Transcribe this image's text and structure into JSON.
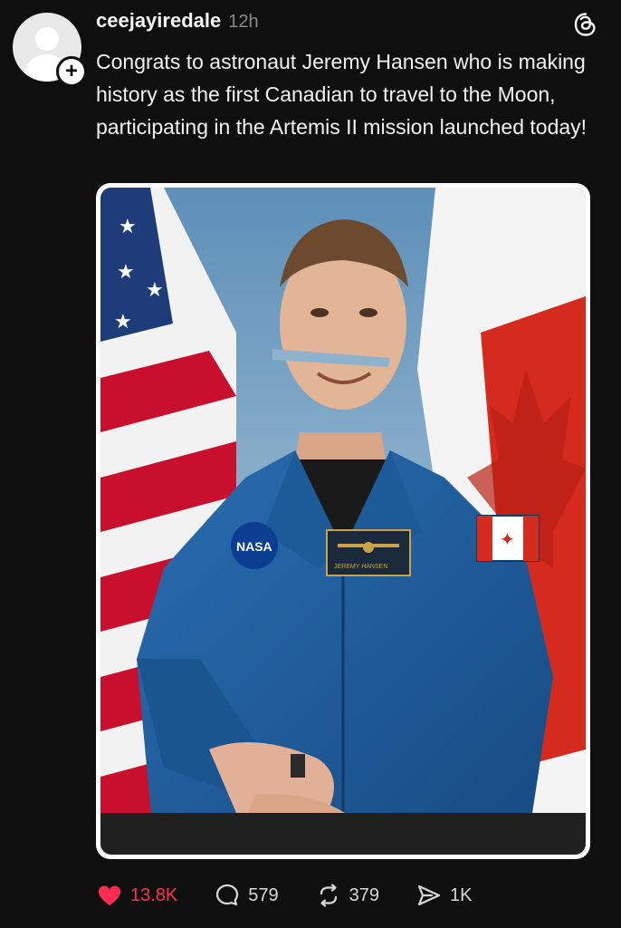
{
  "post": {
    "username": "ceejayiredale",
    "timestamp": "12h",
    "caption": "Congrats to astronaut Jeremy Hansen who is making history as the first Canadian to travel to the Moon, participating in the Artemis II mission launched today!",
    "image": {
      "patch_left": "NASA",
      "name_tag": "JEREMY HANSEN"
    }
  },
  "actions": {
    "likes": "13.8K",
    "replies": "579",
    "reposts": "379",
    "shares": "1K"
  },
  "colors": {
    "background": "#0f0f10",
    "like_red": "#ff2d55",
    "flight_suit_blue": "#1f5d9c"
  },
  "icons": {
    "threads_logo": "threads-logo-icon",
    "like": "heart-icon",
    "reply": "comment-icon",
    "repost": "repost-icon",
    "share": "share-icon",
    "follow": "plus-icon"
  }
}
